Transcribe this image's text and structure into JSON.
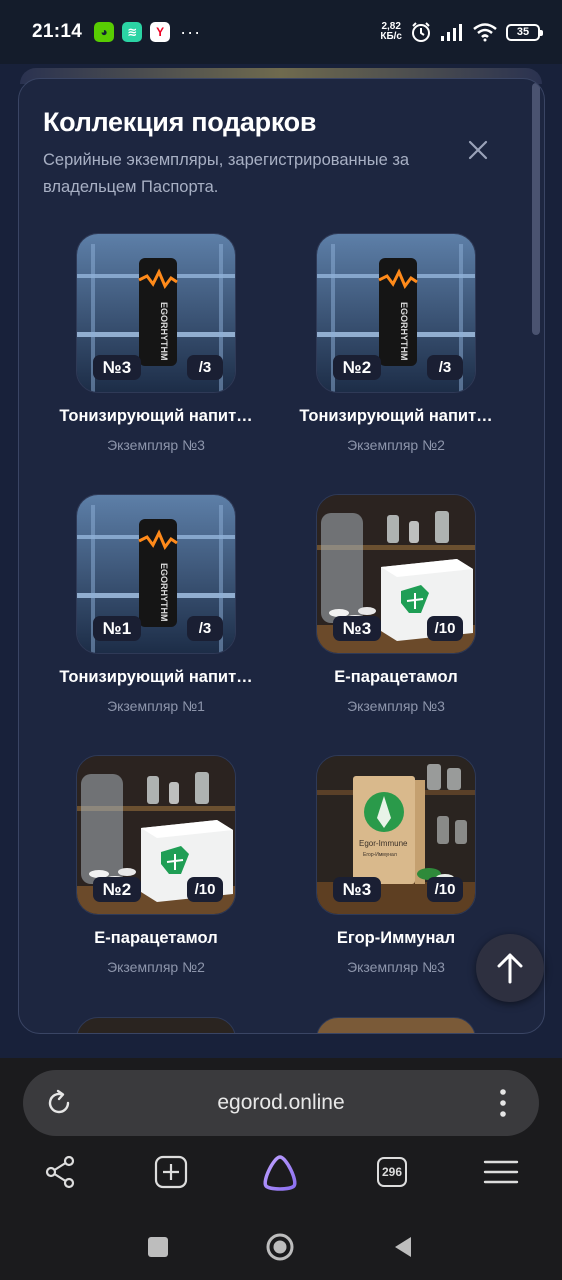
{
  "status_bar": {
    "time": "21:14",
    "more": "···",
    "net_speed_top": "2,82",
    "net_speed_bottom": "КБ/с",
    "battery": "35"
  },
  "modal": {
    "title": "Коллекция подарков",
    "subtitle": "Серийные экземпляры, зарегистрированные за владельцем Паспорта."
  },
  "gifts": [
    {
      "title": "Тонизирующий напит…",
      "subtitle": "Экземпляр №3",
      "number": "№3",
      "total": "/3",
      "image": "energy-drink"
    },
    {
      "title": "Тонизирующий напит…",
      "subtitle": "Экземпляр №2",
      "number": "№2",
      "total": "/3",
      "image": "energy-drink"
    },
    {
      "title": "Тонизирующий напит…",
      "subtitle": "Экземпляр №1",
      "number": "№1",
      "total": "/3",
      "image": "energy-drink"
    },
    {
      "title": "Е-парацетамол",
      "subtitle": "Экземпляр №3",
      "number": "№3",
      "total": "/10",
      "image": "paracetamol-box"
    },
    {
      "title": "Е-парацетамол",
      "subtitle": "Экземпляр №2",
      "number": "№2",
      "total": "/10",
      "image": "paracetamol-box"
    },
    {
      "title": "Егор-Иммунал",
      "subtitle": "Экземпляр №3",
      "number": "№3",
      "total": "/10",
      "image": "immunal-box"
    }
  ],
  "browser": {
    "url": "egorod.online",
    "tabs_count": "296"
  },
  "colors": {
    "modal_bg": "#1d2640",
    "accent_purple": "#a98cf5",
    "badge_bg": "#1a1f33"
  }
}
